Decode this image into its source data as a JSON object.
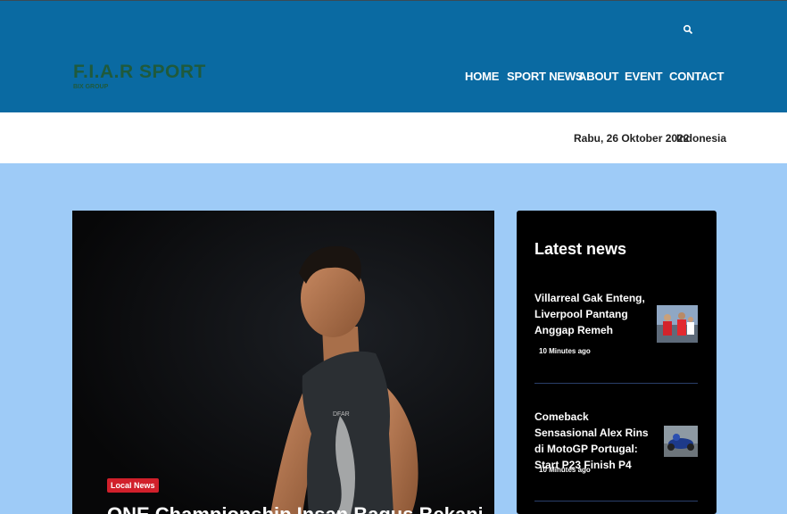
{
  "header": {
    "logo": "F.I.A.R SPORT",
    "logo_sub": "BIX GROUP",
    "nav": [
      "HOME",
      "SPORT NEWS",
      "ABOUT",
      "EVENT",
      "CONTACT"
    ]
  },
  "date_bar": {
    "date": "Rabu, 26 Oktober 2022",
    "country": "Indonesia"
  },
  "hero": {
    "badge": "Local News",
    "title": "ONE Championship Insan Bagus Bekanilla"
  },
  "latest": {
    "title": "Latest news",
    "items": [
      {
        "headline": "Villarreal Gak Enteng, Liverpool Pantang Anggap Remeh",
        "time": "10 Minutes ago"
      },
      {
        "headline": "Comeback Sensasional Alex Rins di MotoGP Portugal: Start P23 Finish P4",
        "time": "10 Minutes ago"
      }
    ]
  },
  "colors": {
    "header_bg": "#0a6aa2",
    "page_bg": "#9ecbf7",
    "badge": "#d1202b",
    "logo": "#1f5a3c"
  },
  "icons": [
    "search-icon"
  ]
}
